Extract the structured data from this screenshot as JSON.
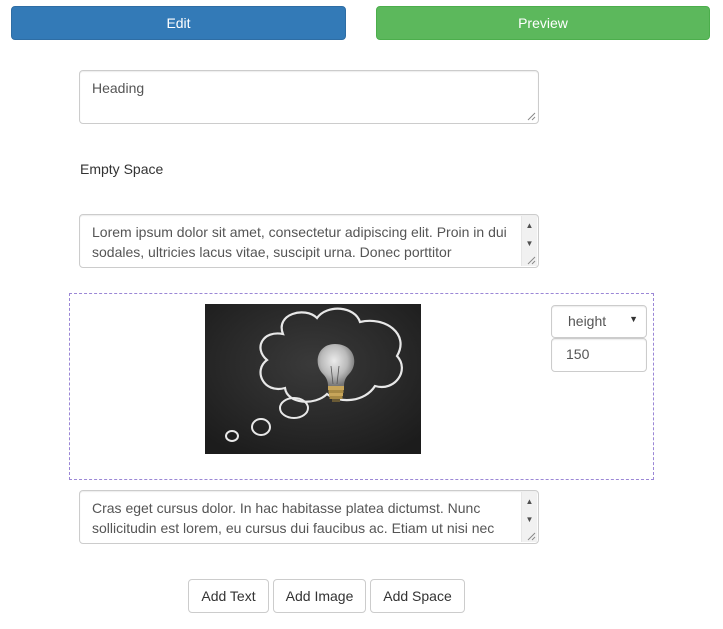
{
  "toolbar": {
    "edit_label": "Edit",
    "preview_label": "Preview"
  },
  "blocks": {
    "heading_text": "Heading",
    "empty_space_label": "Empty Space",
    "paragraph1": "Lorem ipsum dolor sit amet, consectetur adipiscing elit. Proin in dui sodales, ultricies lacus vitae, suscipit urna. Donec porttitor",
    "image": {
      "dimension_option": "height",
      "dimension_value": "150"
    },
    "paragraph2": "Cras eget cursus dolor. In hac habitasse platea dictumst. Nunc sollicitudin est lorem, eu cursus dui faucibus ac. Etiam ut nisi nec"
  },
  "actions": {
    "add_text": "Add Text",
    "add_image": "Add Image",
    "add_space": "Add Space"
  },
  "colors": {
    "primary": "#337ab7",
    "success": "#5cb85c",
    "dashed_border": "#9b87d6"
  }
}
